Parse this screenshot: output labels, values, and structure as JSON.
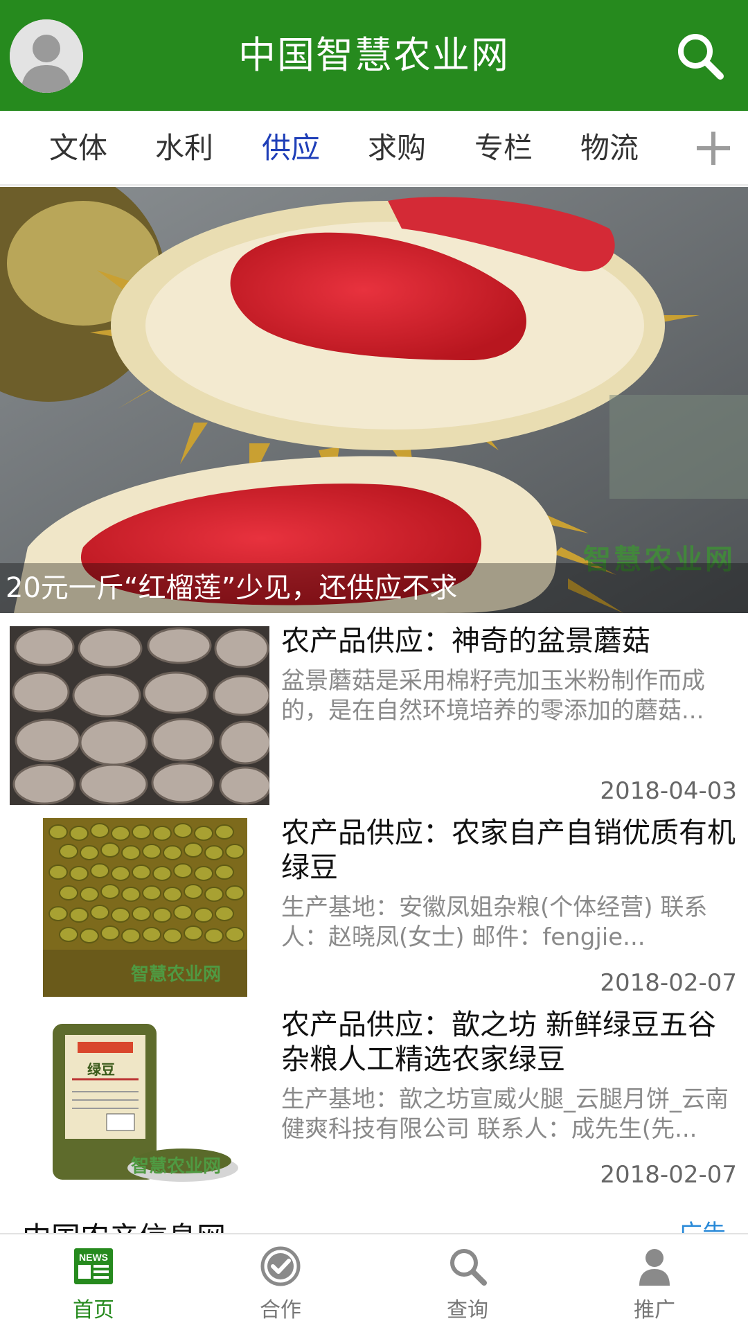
{
  "header": {
    "title": "中国智慧农业网",
    "avatar_icon": "user-avatar-icon",
    "search_icon": "search-icon",
    "background_color": "#268a1e"
  },
  "categories": {
    "items": [
      "文体",
      "水利",
      "供应",
      "求购",
      "专栏",
      "物流"
    ],
    "active": "供应",
    "active_color": "#1f3fb8",
    "more_icon": "plus-icon"
  },
  "banner": {
    "caption": "20元一斤“红榴莲”少见，还供应不求",
    "watermark": "智慧农业网"
  },
  "news": [
    {
      "title": "农产品供应：神奇的盆景蘑菇",
      "summary": "盆景蘑菇是采用棉籽壳加玉米粉制作而成的，是在自然环境培养的零添加的蘑菇...",
      "date": "2018-04-03",
      "thumb_icon": "mushroom-thumbnail"
    },
    {
      "title": "农产品供应：农家自产自销优质有机绿豆",
      "summary": "生产基地：安徽凤姐杂粮(个体经营) 联系人：赵晓凤(女士) 邮件：fengjie...",
      "date": "2018-02-07",
      "thumb_icon": "mung-bean-thumbnail",
      "thumb_watermark": "智慧农业网"
    },
    {
      "title": "农产品供应：歆之坊 新鲜绿豆五谷杂粮人工精选农家绿豆",
      "summary": "生产基地：歆之坊宣威火腿_云腿月饼_云南健爽科技有限公司 联系人：成先生(先...",
      "date": "2018-02-07",
      "thumb_icon": "mung-bean-bag-thumbnail",
      "thumb_label": "绿豆",
      "thumb_watermark": "智慧农业网"
    }
  ],
  "peek_section": {
    "title": "中国农产信息网",
    "ad_label": "广告"
  },
  "tabbar": {
    "tabs": [
      {
        "label": "首页",
        "icon": "news-icon",
        "active": true
      },
      {
        "label": "合作",
        "icon": "check-circle-icon",
        "active": false
      },
      {
        "label": "查询",
        "icon": "search-icon",
        "active": false
      },
      {
        "label": "推广",
        "icon": "person-icon",
        "active": false
      }
    ],
    "news_icon_text": "NEWS",
    "active_color": "#268a1e"
  }
}
